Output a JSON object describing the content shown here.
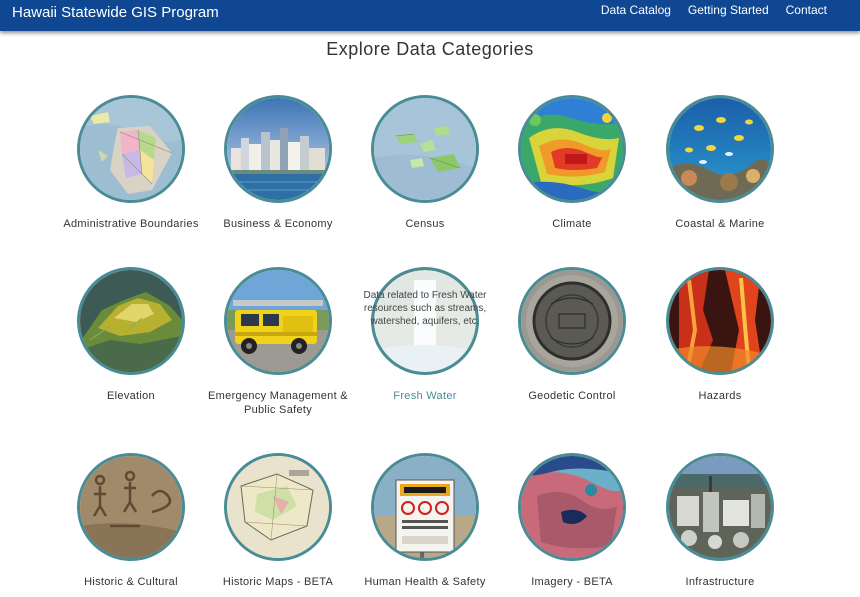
{
  "header": {
    "brand": "Hawaii Statewide GIS Program",
    "nav": [
      "Data Catalog",
      "Getting Started",
      "Contact"
    ],
    "bar_color": "#0f4793"
  },
  "page": {
    "title": "Explore Data Categories"
  },
  "categories": [
    {
      "label": "Administrative Boundaries",
      "icon": "admin-boundaries-map-icon"
    },
    {
      "label": "Business & Economy",
      "icon": "city-skyline-icon"
    },
    {
      "label": "Census",
      "icon": "census-map-icon"
    },
    {
      "label": "Climate",
      "icon": "climate-heatmap-icon"
    },
    {
      "label": "Coastal & Marine",
      "icon": "coral-reef-fish-icon"
    },
    {
      "label": "Elevation",
      "icon": "elevation-terrain-icon"
    },
    {
      "label": "Emergency Management & Public Safety",
      "icon": "fire-truck-icon"
    },
    {
      "label": "Fresh Water",
      "icon": "waterfall-icon",
      "active": true,
      "description": "Data related to Fresh Water resources such as streams, watershed, aquifers, etc."
    },
    {
      "label": "Geodetic Control",
      "icon": "survey-marker-disk-icon"
    },
    {
      "label": "Hazards",
      "icon": "lava-flow-icon"
    },
    {
      "label": "Historic & Cultural",
      "icon": "petroglyph-rock-icon"
    },
    {
      "label": "Historic Maps - BETA",
      "icon": "old-map-icon"
    },
    {
      "label": "Human Health & Safety",
      "icon": "warning-sign-icon"
    },
    {
      "label": "Imagery - BETA",
      "icon": "satellite-imagery-icon"
    },
    {
      "label": "Infrastructure",
      "icon": "industrial-plant-icon"
    }
  ],
  "colors": {
    "ring": "#4a8c96",
    "active_label": "#4a8c96"
  }
}
